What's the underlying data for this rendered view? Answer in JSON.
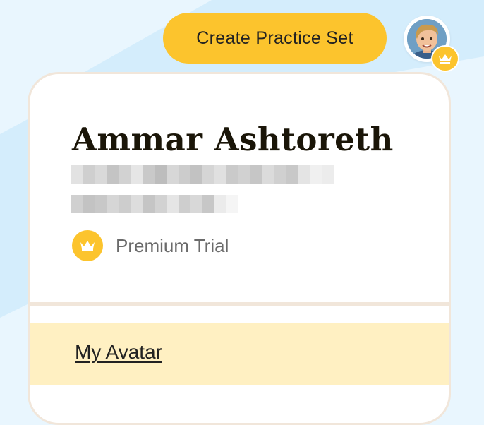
{
  "header": {
    "create_button_label": "Create Practice Set",
    "avatar_icon": "user-avatar",
    "badge_icon": "crown-icon"
  },
  "profile": {
    "name": "Ammar Ashtoreth",
    "plan_icon": "crown-icon",
    "plan_label": "Premium Trial"
  },
  "menu": {
    "items": [
      {
        "label": "My Avatar"
      }
    ]
  },
  "colors": {
    "page_bg": "#e9f6fe",
    "accent_yellow": "#fcc42d",
    "card_border": "#f1e6da",
    "menu_highlight": "#fff0c2",
    "name_color": "#1a1508"
  }
}
